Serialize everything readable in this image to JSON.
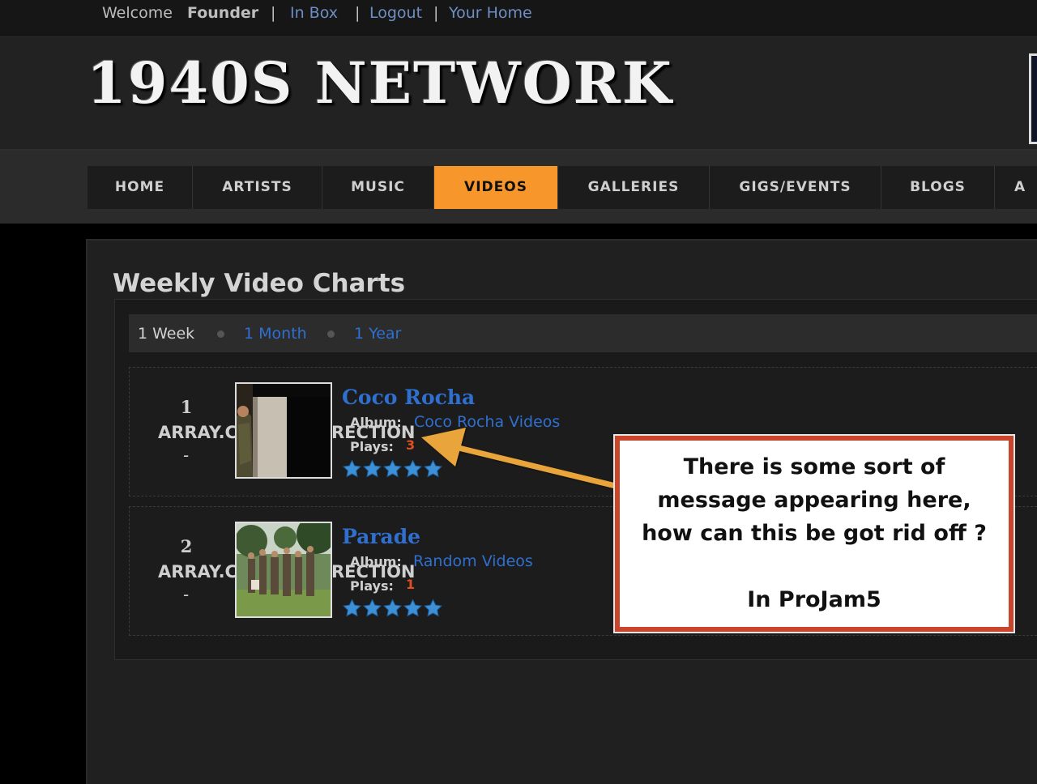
{
  "topbar": {
    "welcome": "Welcome",
    "user": "Founder",
    "separator": "|",
    "links": [
      "In Box",
      "Logout",
      "Your Home"
    ]
  },
  "header": {
    "site_title": "1940S NETWORK"
  },
  "nav": {
    "items": [
      "HOME",
      "ARTISTS",
      "MUSIC",
      "VIDEOS",
      "GALLERIES",
      "GIGS/EVENTS",
      "BLOGS",
      "A"
    ],
    "active": "VIDEOS"
  },
  "page": {
    "title": "Weekly Video Charts"
  },
  "filters": {
    "current": "1 Week",
    "links": [
      "1 Month",
      "1 Year"
    ]
  },
  "videos": [
    {
      "rank": "1",
      "array_left": "ARRAY.C",
      "array_right": "RECTION",
      "dash": "-",
      "title": "Coco Rocha",
      "album_label": "Album:",
      "album": "Coco Rocha Videos",
      "plays_label": "Plays:",
      "plays": "3",
      "rating": 5
    },
    {
      "rank": "2",
      "array_left": "ARRAY.C",
      "array_right": "RECTION",
      "dash": "-",
      "title": "Parade",
      "album_label": "Album:",
      "album": "Random Videos",
      "plays_label": "Plays:",
      "plays": "1",
      "rating": 5
    }
  ],
  "callout": {
    "lines": [
      "There is some sort of",
      "message appearing here,",
      "how can this be got rid off ?",
      "",
      "In ProJam5"
    ]
  },
  "colors": {
    "accent": "#f7962b",
    "link": "#2f6fd0",
    "callout_border": "#c9452b",
    "arrow": "#e9a43a"
  }
}
